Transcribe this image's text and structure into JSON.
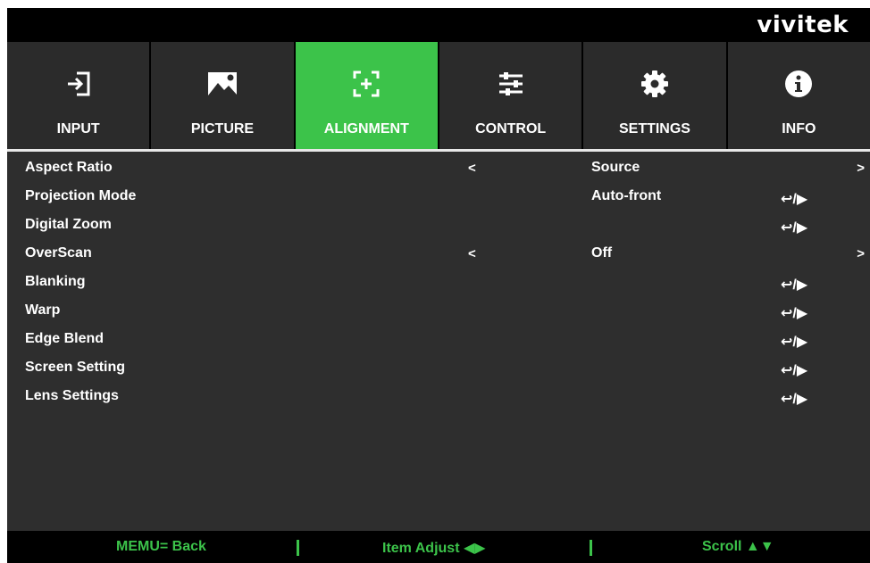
{
  "brand": "vivitek",
  "tabs": [
    {
      "label": "INPUT",
      "icon": "input-icon"
    },
    {
      "label": "PICTURE",
      "icon": "picture-icon"
    },
    {
      "label": "ALIGNMENT",
      "icon": "alignment-icon",
      "active": true
    },
    {
      "label": "CONTROL",
      "icon": "control-sliders-icon"
    },
    {
      "label": "SETTINGS",
      "icon": "gear-icon"
    },
    {
      "label": "INFO",
      "icon": "info-icon"
    }
  ],
  "menu": {
    "items": [
      {
        "label": "Aspect Ratio",
        "left_arrow": "<",
        "value": "Source",
        "right_arrow": ">"
      },
      {
        "label": "Projection Mode",
        "value": "Auto-front",
        "enter": "↩/▶"
      },
      {
        "label": "Digital Zoom",
        "enter": "↩/▶"
      },
      {
        "label": "OverScan",
        "left_arrow": "<",
        "value": "Off",
        "right_arrow": ">"
      },
      {
        "label": "Blanking",
        "enter": "↩/▶"
      },
      {
        "label": "Warp",
        "enter": "↩/▶"
      },
      {
        "label": "Edge Blend",
        "enter": "↩/▶"
      },
      {
        "label": "Screen Setting",
        "enter": "↩/▶"
      },
      {
        "label": "Lens Settings",
        "enter": "↩/▶"
      }
    ]
  },
  "footer": {
    "back": "MEMU= Back",
    "adjust": "Item Adjust ◀▶",
    "scroll": "Scroll ▲▼"
  },
  "colors": {
    "accent": "#3cc34a",
    "panel": "#2e2e2e",
    "bar": "#000000",
    "text": "#ffffff"
  }
}
